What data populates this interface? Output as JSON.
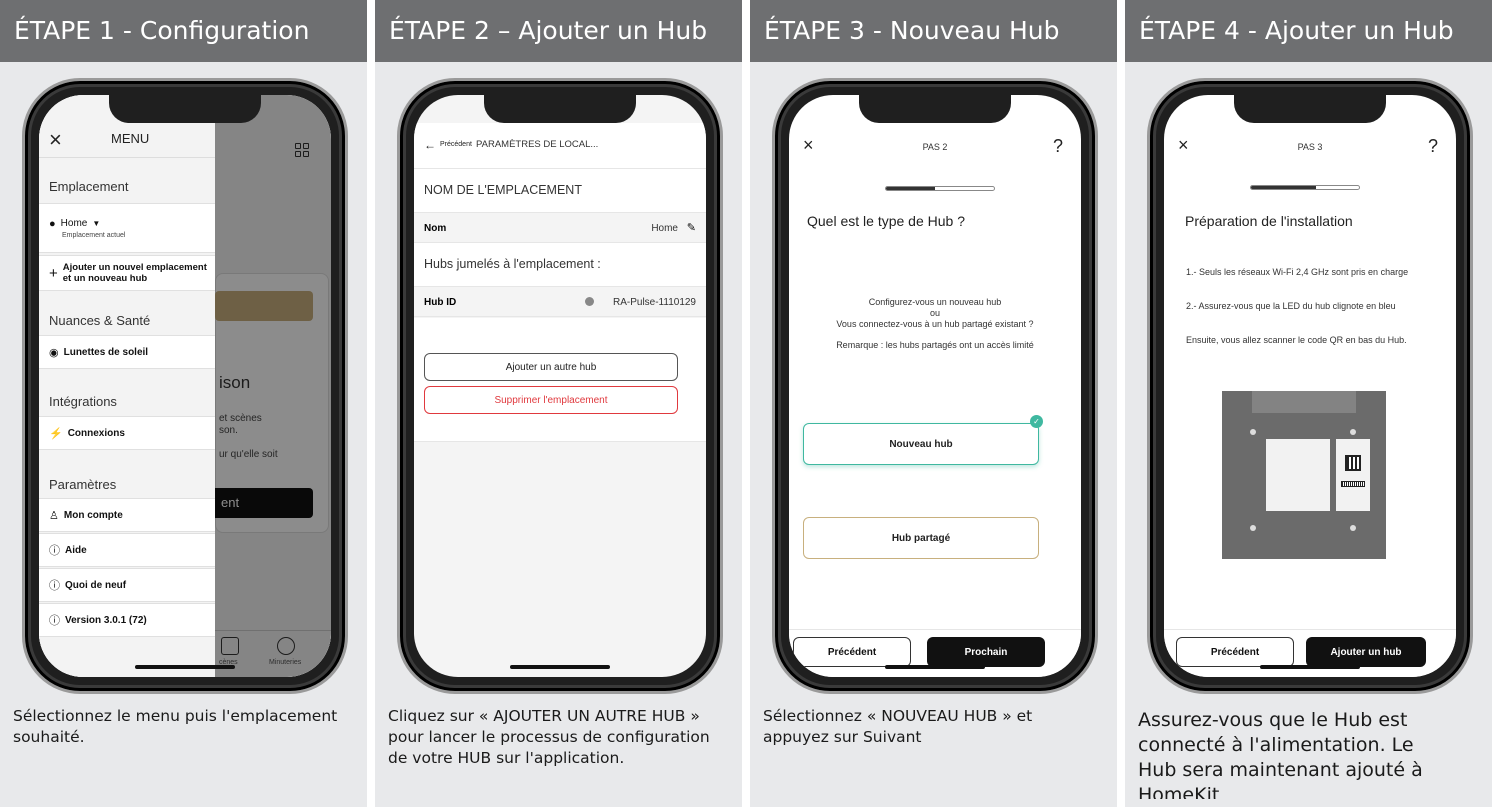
{
  "steps": [
    {
      "header": "ÉTAPE 1 - Configuration",
      "caption": "Sélectionnez le menu puis l'emplacement souhaité.",
      "screen": {
        "menu_title": "MENU",
        "sections": [
          "Emplacement",
          "Nuances & Santé",
          "Intégrations",
          "Paramètres"
        ],
        "location_name": "Home",
        "location_sub": "Emplacement actuel",
        "add_location": "Ajouter un nouvel emplacement et un nouveau hub",
        "sunglasses": "Lunettes de soleil",
        "connections": "Connexions",
        "account": "Mon compte",
        "help": "Aide",
        "whats_new": "Quoi de neuf",
        "version": "Version 3.0.1 (72)",
        "bg_text_1": "ison",
        "bg_text_2": "et scènes",
        "bg_text_3": "son.",
        "bg_text_4": "ur qu'elle soit",
        "bg_button": "ent",
        "bg_tab_scenes": "cènes",
        "bg_tab_timers": "Minuteries"
      }
    },
    {
      "header": "ÉTAPE 2 – Ajouter un Hub",
      "caption": "Cliquez sur « AJOUTER UN AUTRE HUB » pour lancer le processus de configuration de votre HUB sur l'application.",
      "screen": {
        "back": "Précédent",
        "title": "PARAMÈTRES DE LOCAL...",
        "location_header": "NOM DE L'EMPLACEMENT",
        "name_label": "Nom",
        "name_value": "Home",
        "hubs_header": "Hubs jumelés à l'emplacement :",
        "hub_id_label": "Hub ID",
        "hub_id_value": "RA-Pulse-1110129",
        "add_hub": "Ajouter un autre hub",
        "delete_location": "Supprimer l'emplacement"
      }
    },
    {
      "header": "ÉTAPE 3 - Nouveau Hub",
      "caption": "Sélectionnez « NOUVEAU HUB » et appuyez sur Suivant",
      "screen": {
        "step": "PAS 2",
        "help": "?",
        "progress": 0.45,
        "question": "Quel est le type de Hub ?",
        "line1": "Configurez-vous un nouveau hub",
        "line2": "ou",
        "line3": "Vous connectez-vous à un hub partagé existant ?",
        "remark": "Remarque : les hubs partagés ont un accès limité",
        "option_new": "Nouveau hub",
        "option_shared": "Hub partagé",
        "prev": "Précédent",
        "next": "Prochain"
      }
    },
    {
      "header": "ÉTAPE 4 - Ajouter un Hub",
      "caption": "Assurez-vous que le Hub est connecté à l'alimentation. Le Hub sera maintenant ajouté à HomeKit",
      "screen": {
        "step": "PAS 3",
        "help": "?",
        "progress": 0.6,
        "title": "Préparation de l'installation",
        "p1": "1.- Seuls les réseaux Wi-Fi 2,4 GHz sont pris en charge",
        "p2": "2.- Assurez-vous que la LED du hub clignote en bleu",
        "p3": "Ensuite, vous allez scanner le code QR en bas du Hub.",
        "prev": "Précédent",
        "add": "Ajouter un hub"
      }
    }
  ],
  "colors": {
    "header_bg": "#6e6f71",
    "card_bg": "#e8e9eb",
    "danger": "#e0393e",
    "accent_green": "#3fb8a0",
    "gold": "#c8b07e"
  },
  "icons": [
    "close-icon",
    "grid-icon",
    "location-pin-icon",
    "plus-icon",
    "sunglasses-icon",
    "plug-icon",
    "user-icon",
    "help-circle-icon",
    "info-icon",
    "back-arrow-icon",
    "edit-pencil-icon",
    "check-icon"
  ]
}
